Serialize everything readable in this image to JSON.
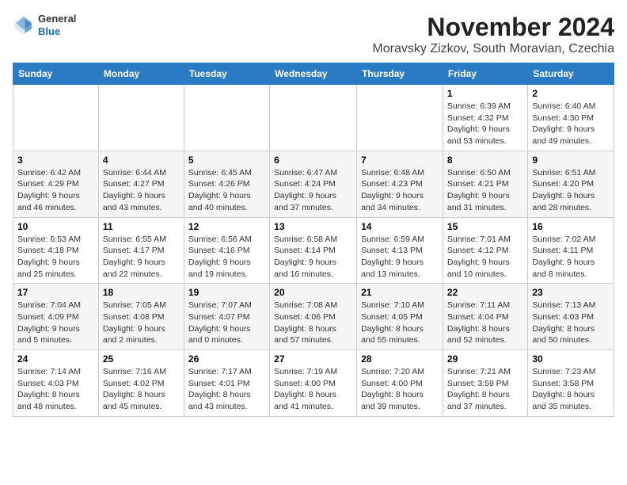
{
  "header": {
    "logo_line1": "General",
    "logo_line2": "Blue",
    "month": "November 2024",
    "location": "Moravsky Zizkov, South Moravian, Czechia"
  },
  "weekdays": [
    "Sunday",
    "Monday",
    "Tuesday",
    "Wednesday",
    "Thursday",
    "Friday",
    "Saturday"
  ],
  "weeks": [
    [
      {
        "day": "",
        "info": ""
      },
      {
        "day": "",
        "info": ""
      },
      {
        "day": "",
        "info": ""
      },
      {
        "day": "",
        "info": ""
      },
      {
        "day": "",
        "info": ""
      },
      {
        "day": "1",
        "info": "Sunrise: 6:39 AM\nSunset: 4:32 PM\nDaylight: 9 hours and 53 minutes."
      },
      {
        "day": "2",
        "info": "Sunrise: 6:40 AM\nSunset: 4:30 PM\nDaylight: 9 hours and 49 minutes."
      }
    ],
    [
      {
        "day": "3",
        "info": "Sunrise: 6:42 AM\nSunset: 4:29 PM\nDaylight: 9 hours and 46 minutes."
      },
      {
        "day": "4",
        "info": "Sunrise: 6:44 AM\nSunset: 4:27 PM\nDaylight: 9 hours and 43 minutes."
      },
      {
        "day": "5",
        "info": "Sunrise: 6:45 AM\nSunset: 4:26 PM\nDaylight: 9 hours and 40 minutes."
      },
      {
        "day": "6",
        "info": "Sunrise: 6:47 AM\nSunset: 4:24 PM\nDaylight: 9 hours and 37 minutes."
      },
      {
        "day": "7",
        "info": "Sunrise: 6:48 AM\nSunset: 4:23 PM\nDaylight: 9 hours and 34 minutes."
      },
      {
        "day": "8",
        "info": "Sunrise: 6:50 AM\nSunset: 4:21 PM\nDaylight: 9 hours and 31 minutes."
      },
      {
        "day": "9",
        "info": "Sunrise: 6:51 AM\nSunset: 4:20 PM\nDaylight: 9 hours and 28 minutes."
      }
    ],
    [
      {
        "day": "10",
        "info": "Sunrise: 6:53 AM\nSunset: 4:18 PM\nDaylight: 9 hours and 25 minutes."
      },
      {
        "day": "11",
        "info": "Sunrise: 6:55 AM\nSunset: 4:17 PM\nDaylight: 9 hours and 22 minutes."
      },
      {
        "day": "12",
        "info": "Sunrise: 6:56 AM\nSunset: 4:16 PM\nDaylight: 9 hours and 19 minutes."
      },
      {
        "day": "13",
        "info": "Sunrise: 6:58 AM\nSunset: 4:14 PM\nDaylight: 9 hours and 16 minutes."
      },
      {
        "day": "14",
        "info": "Sunrise: 6:59 AM\nSunset: 4:13 PM\nDaylight: 9 hours and 13 minutes."
      },
      {
        "day": "15",
        "info": "Sunrise: 7:01 AM\nSunset: 4:12 PM\nDaylight: 9 hours and 10 minutes."
      },
      {
        "day": "16",
        "info": "Sunrise: 7:02 AM\nSunset: 4:11 PM\nDaylight: 9 hours and 8 minutes."
      }
    ],
    [
      {
        "day": "17",
        "info": "Sunrise: 7:04 AM\nSunset: 4:09 PM\nDaylight: 9 hours and 5 minutes."
      },
      {
        "day": "18",
        "info": "Sunrise: 7:05 AM\nSunset: 4:08 PM\nDaylight: 9 hours and 2 minutes."
      },
      {
        "day": "19",
        "info": "Sunrise: 7:07 AM\nSunset: 4:07 PM\nDaylight: 9 hours and 0 minutes."
      },
      {
        "day": "20",
        "info": "Sunrise: 7:08 AM\nSunset: 4:06 PM\nDaylight: 8 hours and 57 minutes."
      },
      {
        "day": "21",
        "info": "Sunrise: 7:10 AM\nSunset: 4:05 PM\nDaylight: 8 hours and 55 minutes."
      },
      {
        "day": "22",
        "info": "Sunrise: 7:11 AM\nSunset: 4:04 PM\nDaylight: 8 hours and 52 minutes."
      },
      {
        "day": "23",
        "info": "Sunrise: 7:13 AM\nSunset: 4:03 PM\nDaylight: 8 hours and 50 minutes."
      }
    ],
    [
      {
        "day": "24",
        "info": "Sunrise: 7:14 AM\nSunset: 4:03 PM\nDaylight: 8 hours and 48 minutes."
      },
      {
        "day": "25",
        "info": "Sunrise: 7:16 AM\nSunset: 4:02 PM\nDaylight: 8 hours and 45 minutes."
      },
      {
        "day": "26",
        "info": "Sunrise: 7:17 AM\nSunset: 4:01 PM\nDaylight: 8 hours and 43 minutes."
      },
      {
        "day": "27",
        "info": "Sunrise: 7:19 AM\nSunset: 4:00 PM\nDaylight: 8 hours and 41 minutes."
      },
      {
        "day": "28",
        "info": "Sunrise: 7:20 AM\nSunset: 4:00 PM\nDaylight: 8 hours and 39 minutes."
      },
      {
        "day": "29",
        "info": "Sunrise: 7:21 AM\nSunset: 3:59 PM\nDaylight: 8 hours and 37 minutes."
      },
      {
        "day": "30",
        "info": "Sunrise: 7:23 AM\nSunset: 3:58 PM\nDaylight: 8 hours and 35 minutes."
      }
    ]
  ]
}
